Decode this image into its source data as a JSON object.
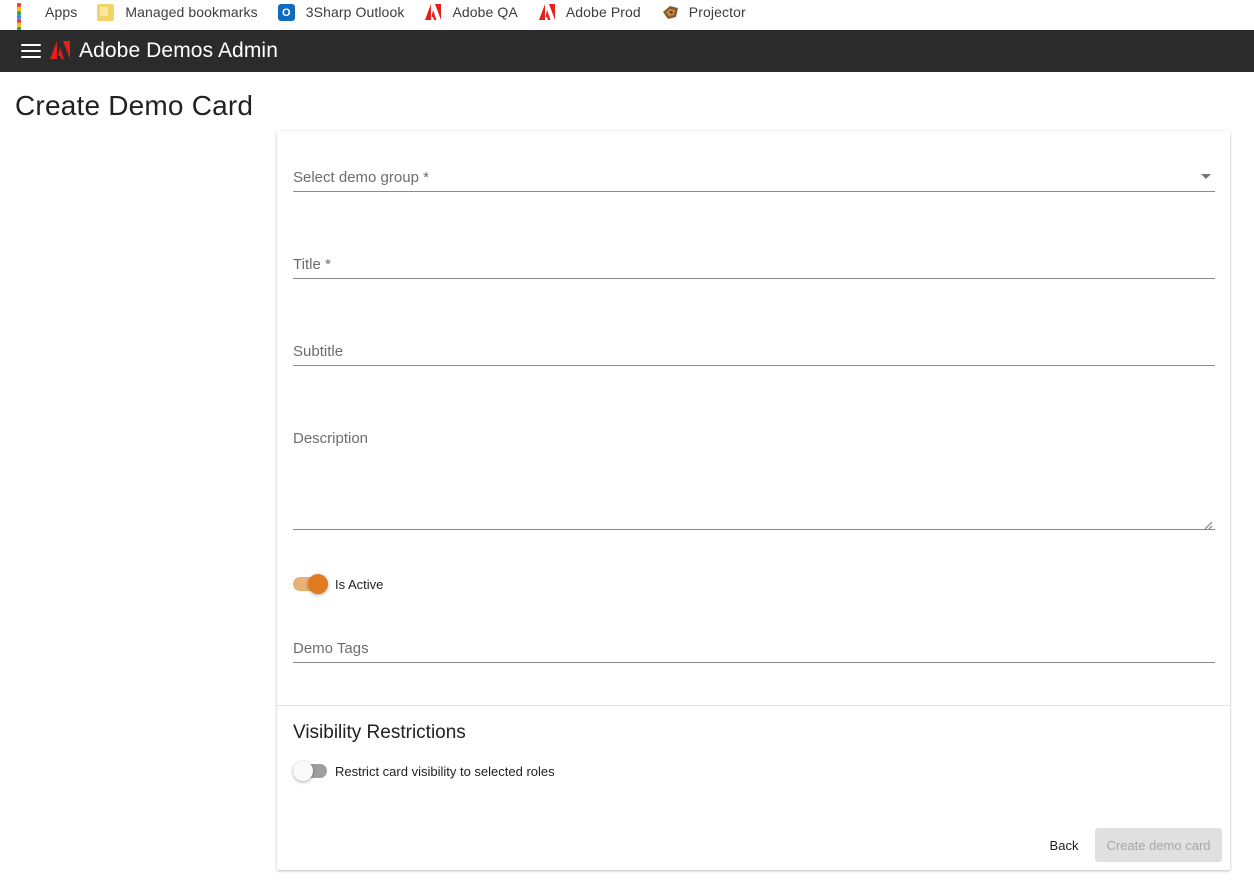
{
  "bookmarks": [
    {
      "label": "Apps",
      "icon": "apps-grid-icon"
    },
    {
      "label": "Managed bookmarks",
      "icon": "folder-icon"
    },
    {
      "label": "3Sharp Outlook",
      "icon": "outlook-icon"
    },
    {
      "label": "Adobe QA",
      "icon": "adobe-icon"
    },
    {
      "label": "Adobe Prod",
      "icon": "adobe-icon"
    },
    {
      "label": "Projector",
      "icon": "projector-icon"
    }
  ],
  "appbar": {
    "title": "Adobe Demos Admin",
    "background": "#2b2b2b"
  },
  "page": {
    "title": "Create Demo Card"
  },
  "form": {
    "demo_group": {
      "label": "Select demo group *",
      "value": ""
    },
    "title": {
      "label": "Title *",
      "value": ""
    },
    "subtitle": {
      "label": "Subtitle",
      "value": ""
    },
    "description": {
      "label": "Description",
      "value": ""
    },
    "is_active": {
      "label": "Is Active",
      "checked": true
    },
    "demo_tags": {
      "label": "Demo Tags",
      "value": ""
    }
  },
  "visibility": {
    "title": "Visibility Restrictions",
    "restrict": {
      "label": "Restrict card visibility to selected roles",
      "checked": false
    }
  },
  "actions": {
    "back_label": "Back",
    "create_label": "Create demo card",
    "create_disabled": true
  },
  "colors": {
    "accent": "#e07b1f",
    "accent_track": "#e8b276",
    "adobe_red": "#e5201b"
  }
}
